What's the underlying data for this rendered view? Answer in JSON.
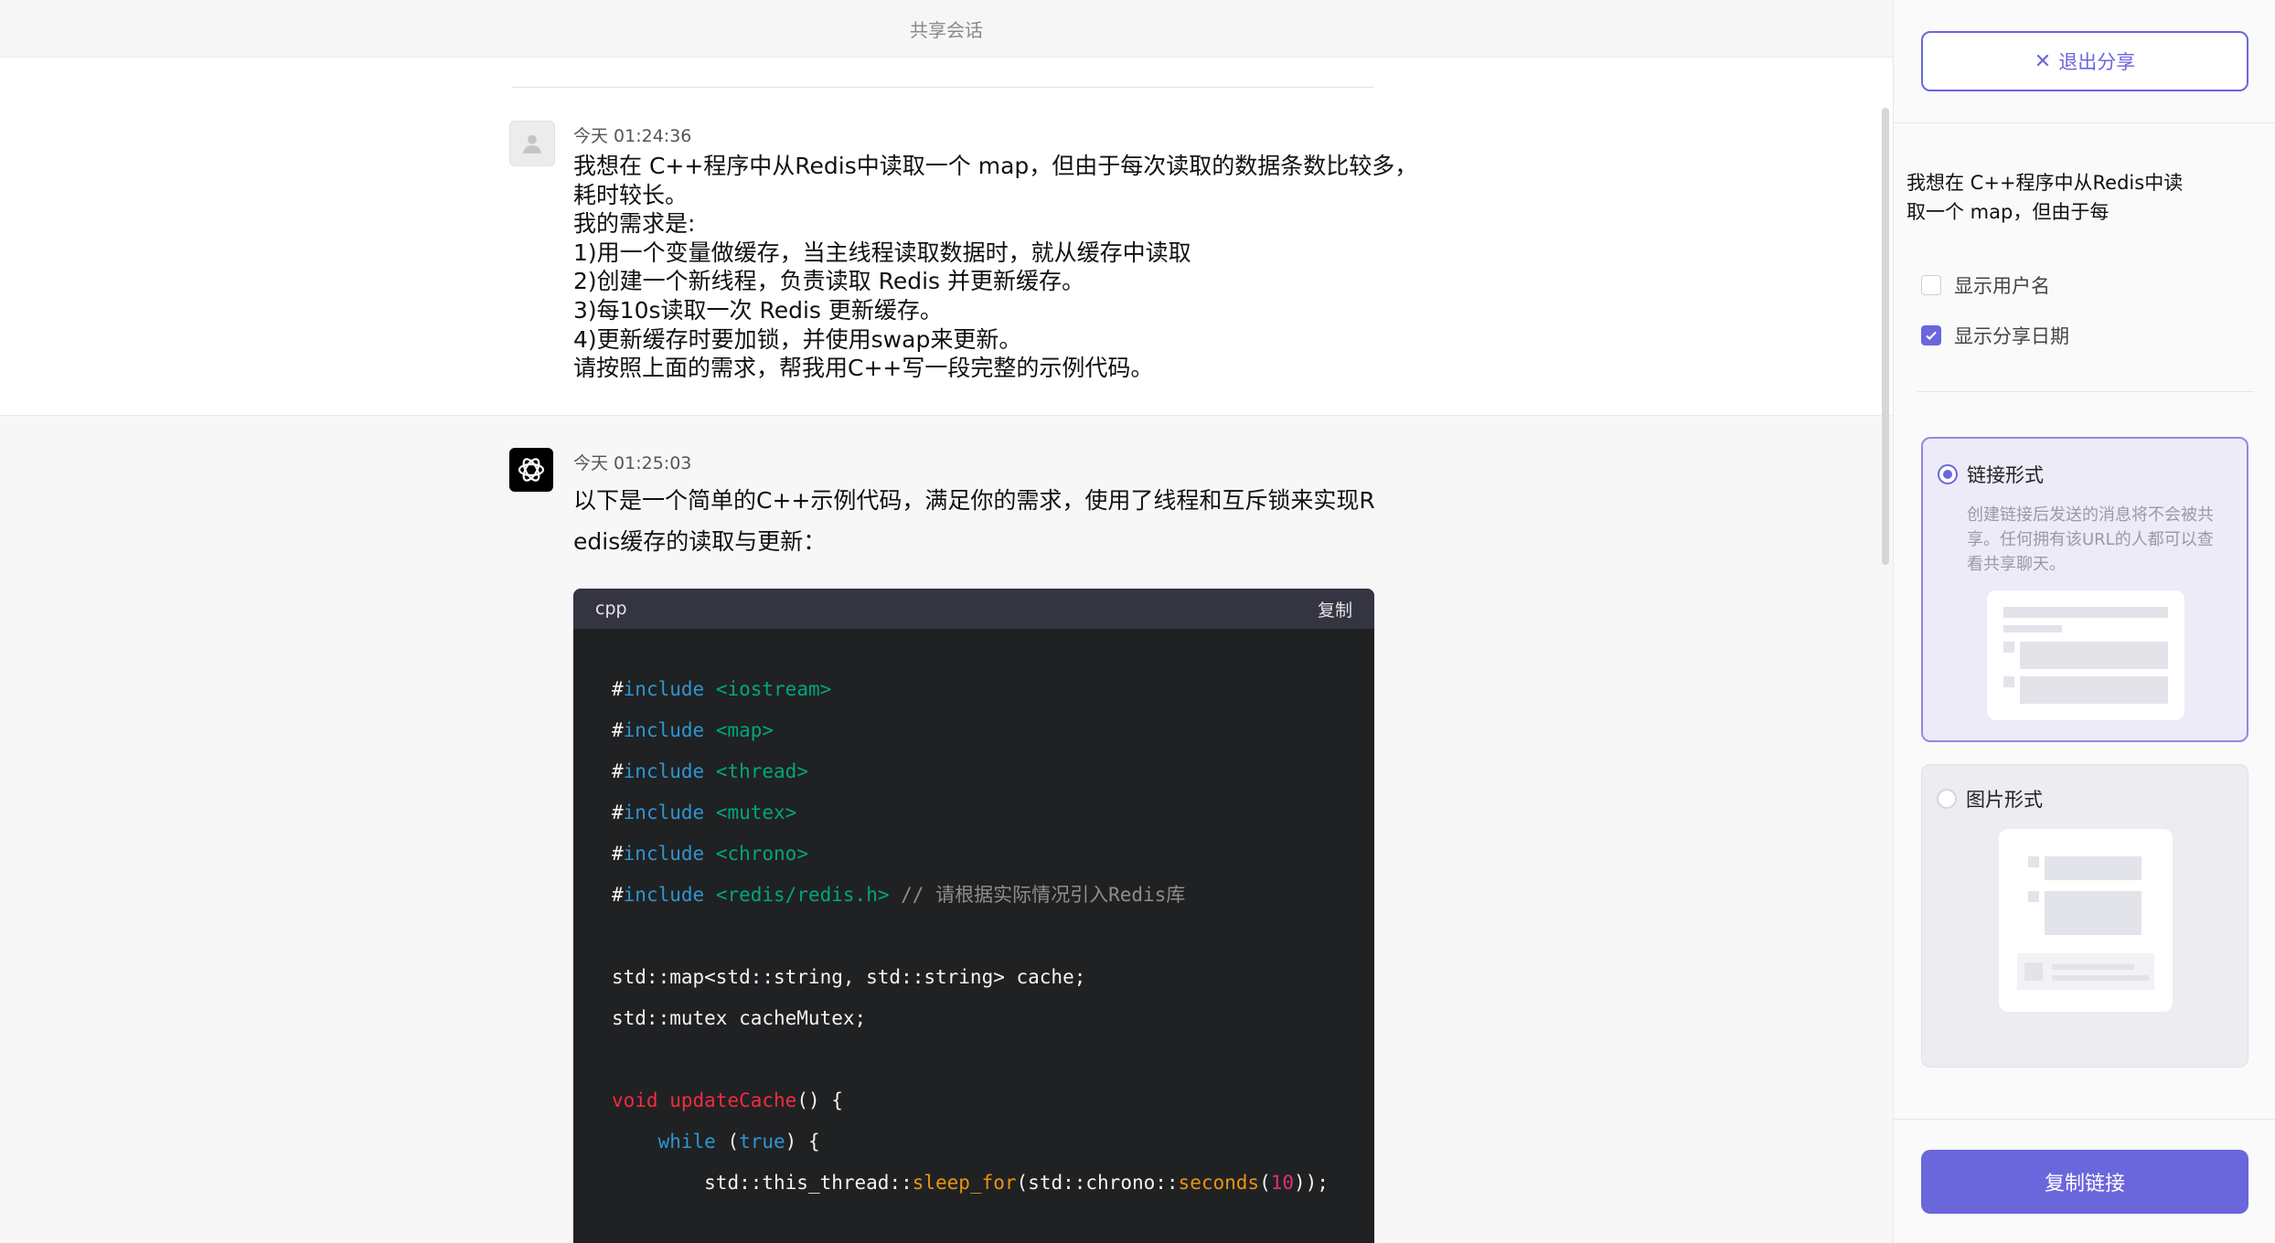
{
  "header": {
    "title": "共享会话"
  },
  "user_message": {
    "timestamp": "今天 01:24:36",
    "lines": [
      "我想在 C++程序中从Redis中读取一个 map，但由于每次读取的数据条数比较多，",
      "耗时较长。",
      "我的需求是:",
      "1)用一个变量做缓存，当主线程读取数据时，就从缓存中读取",
      "2)创建一个新线程，负责读取 Redis 并更新缓存。",
      "3)每10s读取一次 Redis 更新缓存。",
      "4)更新缓存时要加锁，并使用swap来更新。",
      "请按照上面的需求，帮我用C++写一段完整的示例代码。"
    ]
  },
  "bot_message": {
    "timestamp": "今天 01:25:03",
    "lines": [
      "以下是一个简单的C++示例代码，满足你的需求，使用了线程和互斥锁来实现R",
      "edis缓存的读取与更新："
    ],
    "code": {
      "language": "cpp",
      "copy_label": "复制",
      "include_hash": "#",
      "include_kw": "include",
      "includes": [
        "<iostream>",
        "<map>",
        "<thread>",
        "<mutex>",
        "<chrono>",
        "<redis/redis.h>"
      ],
      "include_comment": "// 请根据实际情况引入Redis库",
      "decl1": "std::map<std::string, std::string> cache;",
      "decl2": "std::mutex cacheMutex;",
      "void_kw": "void",
      "fn_name": "updateCache",
      "fn_tail": "() {",
      "while_kw": "while",
      "paren_open": " (",
      "true_kw": "true",
      "while_tail": ") {",
      "sleep_prefix": "std::this_thread::",
      "sleep_fn": "sleep_for",
      "sleep_mid": "(std::chrono::",
      "seconds_fn": "seconds",
      "paren": "(",
      "ten": "10",
      "sleep_tail": "));"
    }
  },
  "share_panel": {
    "exit_label": "退出分享",
    "preview_lines": [
      "我想在 C++程序中从Redis中读",
      "取一个 map，但由于每"
    ],
    "show_username_label": "显示用户名",
    "show_username_checked": false,
    "show_date_label": "显示分享日期",
    "show_date_checked": true,
    "link_option": {
      "title": "链接形式",
      "selected": true,
      "desc_lines": [
        "创建链接后发送的消息将不会被共",
        "享。任何拥有该URL的人都可以查",
        "看共享聊天。"
      ]
    },
    "image_option": {
      "title": "图片形式",
      "selected": false
    },
    "copy_link_label": "复制链接",
    "accent_color": "#6a66dc"
  }
}
